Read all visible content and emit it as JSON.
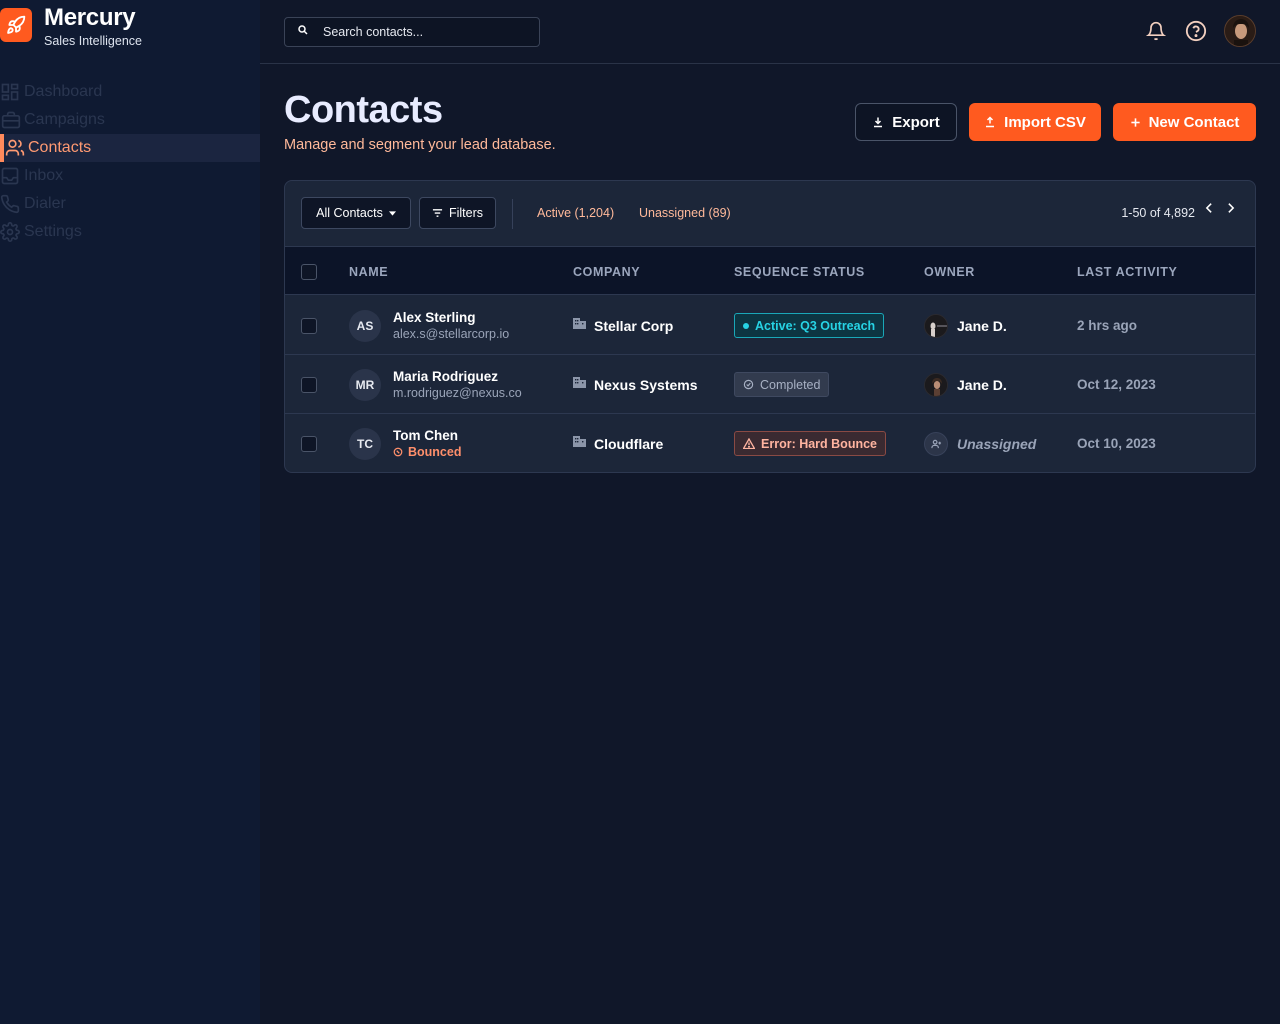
{
  "brand": {
    "name": "Mercury",
    "tagline": "Sales Intelligence"
  },
  "sidebar": {
    "items": [
      {
        "label": "Dashboard",
        "icon": "dashboard-icon",
        "active": false
      },
      {
        "label": "Campaigns",
        "icon": "campaigns-icon",
        "active": false
      },
      {
        "label": "Contacts",
        "icon": "contacts-icon",
        "active": true
      },
      {
        "label": "Inbox",
        "icon": "inbox-icon",
        "active": false
      },
      {
        "label": "Dialer",
        "icon": "phone-icon",
        "active": false
      },
      {
        "label": "Settings",
        "icon": "gear-icon",
        "active": false
      }
    ]
  },
  "search": {
    "placeholder": "Search contacts...",
    "value": ""
  },
  "header": {
    "title": "Contacts",
    "subtitle": "Manage and segment your lead database.",
    "export_label": "Export",
    "import_label": "Import CSV",
    "new_label": "New Contact"
  },
  "toolbar": {
    "view_label": "All Contacts",
    "filters_label": "Filters",
    "segment_active": "Active (1,204)",
    "segment_unassigned": "Unassigned (89)",
    "pagination": "1-50 of 4,892"
  },
  "table": {
    "columns": [
      "NAME",
      "COMPANY",
      "SEQUENCE STATUS",
      "OWNER",
      "LAST ACTIVITY"
    ],
    "rows": [
      {
        "initials": "AS",
        "name": "Alex Sterling",
        "sub": "alex.s@stellarcorp.io",
        "company": "Stellar Corp",
        "status": "Active: Q3 Outreach",
        "owner": "Jane D.",
        "last_activity": "2 hrs ago"
      },
      {
        "initials": "MR",
        "name": "Maria Rodriguez",
        "sub": "m.rodriguez@nexus.co",
        "company": "Nexus Systems",
        "status": "Completed",
        "owner": "Jane D.",
        "last_activity": "Oct 12, 2023"
      },
      {
        "initials": "TC",
        "name": "Tom Chen",
        "sub": "Bounced",
        "company": "Cloudflare",
        "status": "Error: Hard Bounce",
        "owner": "Unassigned",
        "last_activity": "Oct 10, 2023"
      }
    ]
  },
  "colors": {
    "accent": "#ff5a1f",
    "background": "#101729",
    "sidebar": "#0f1a32",
    "active_status": "#27d3e4",
    "error_status": "#ffb4a0"
  }
}
